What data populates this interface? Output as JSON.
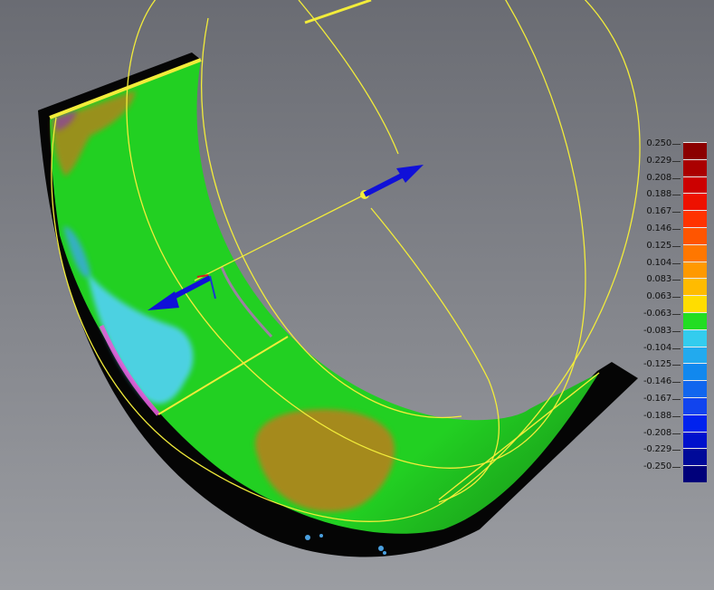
{
  "viewport": {
    "name": "3d-deviation-view",
    "background_top": "#6a6c73",
    "background_bottom": "#9b9da2"
  },
  "colors": {
    "green_in_tolerance": "#22d022",
    "olive_positive": "#a58a1e",
    "cyan_negative": "#4fd2ec",
    "magenta_edge": "#e35cd9",
    "gizmo_blue": "#1010d8",
    "gizmo_yellow": "#f2ec3a",
    "shadow": "#050505"
  },
  "legend": {
    "labels": [
      "0.250",
      "0.229",
      "0.208",
      "0.188",
      "0.167",
      "0.146",
      "0.125",
      "0.104",
      "0.083",
      "0.063",
      "-0.063",
      "-0.083",
      "-0.104",
      "-0.125",
      "-0.146",
      "-0.167",
      "-0.188",
      "-0.208",
      "-0.229",
      "-0.250"
    ],
    "colors": [
      "#8b0000",
      "#aa0000",
      "#cc0000",
      "#ee1100",
      "#ff3300",
      "#ff5500",
      "#ff7700",
      "#ff9900",
      "#ffbb00",
      "#ffdd00",
      "#22dd22",
      "#33ccee",
      "#22aaee",
      "#1188ee",
      "#1166ee",
      "#1144ee",
      "#0022ee",
      "#0011cc",
      "#000a99",
      "#00007a"
    ]
  }
}
